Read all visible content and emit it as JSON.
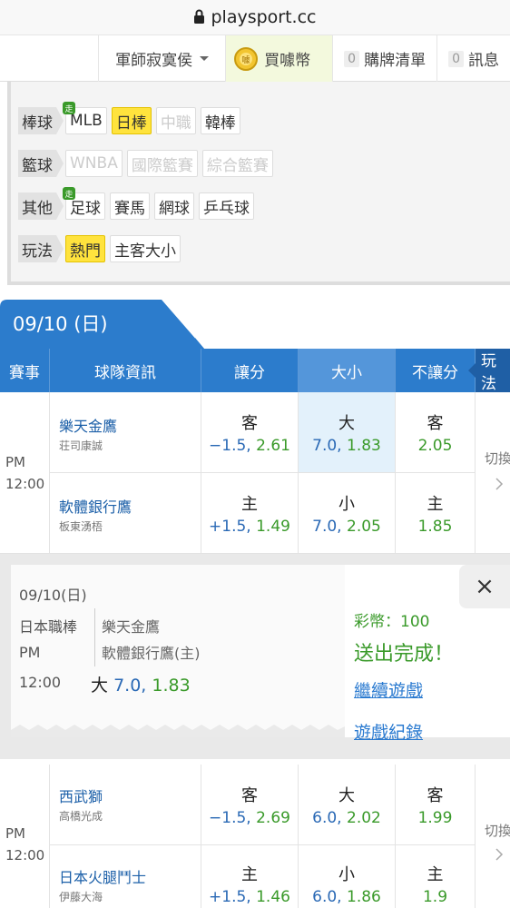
{
  "browser": {
    "url": "playsport.cc"
  },
  "topnav": {
    "user": "軍師寂寞侯",
    "coin": "買噱幣",
    "cart_count": "0",
    "cart": "購牌清單",
    "msg_count": "0",
    "msg": "訊息"
  },
  "filters": {
    "rows": [
      {
        "category": "棒球",
        "tags": [
          "MLB",
          "日棒",
          "中職",
          "韓棒"
        ]
      },
      {
        "category": "籃球",
        "tags": [
          "WNBA",
          "國際籃賽",
          "綜合籃賽"
        ]
      },
      {
        "category": "其他",
        "tags": [
          "足球",
          "賽馬",
          "網球",
          "乒乓球"
        ]
      },
      {
        "category": "玩法",
        "tags": [
          "熱門",
          "主客大小"
        ]
      }
    ],
    "walk_badge": "走"
  },
  "date_header": "09/10 (日)",
  "table_header": [
    "賽事",
    "球隊資訊",
    "讓分",
    "大小",
    "不讓分",
    "玩法"
  ],
  "games": [
    {
      "time_ampm": "PM",
      "time": "12:00",
      "switch": "切換",
      "away": {
        "team": "樂天金鷹",
        "pitcher": "荘司康誠",
        "spread_side": "客",
        "spread": "−1.5,",
        "spread_odds": "2.61",
        "ou_side": "大",
        "ou": "7.0,",
        "ou_odds": "1.83",
        "ml_side": "客",
        "ml": "2.05"
      },
      "home": {
        "team": "軟體銀行鷹",
        "pitcher": "板東湧梧",
        "spread_side": "主",
        "spread": "+1.5,",
        "spread_odds": "1.49",
        "ou_side": "小",
        "ou": "7.0,",
        "ou_odds": "2.05",
        "ml_side": "主",
        "ml": "1.85"
      }
    },
    {
      "time_ampm": "PM",
      "time": "12:00",
      "switch": "切換",
      "away": {
        "team": "西武獅",
        "pitcher": "高橋光成",
        "spread_side": "客",
        "spread": "−1.5,",
        "spread_odds": "2.69",
        "ou_side": "大",
        "ou": "6.0,",
        "ou_odds": "2.02",
        "ml_side": "客",
        "ml": "1.99"
      },
      "home": {
        "team": "日本火腿鬥士",
        "pitcher": "伊藤大海",
        "spread_side": "主",
        "spread": "+1.5,",
        "spread_odds": "1.46",
        "ou_side": "小",
        "ou": "6.0,",
        "ou_odds": "1.86",
        "ml_side": "主",
        "ml": "1.9"
      }
    }
  ],
  "popup": {
    "date": "09/10(日)",
    "league": "日本職棒",
    "ampm": "PM",
    "time": "12:00",
    "away": "樂天金鷹",
    "home": "軟體銀行鷹(主)",
    "pick_side": "大",
    "pick_line": "7.0,",
    "pick_odds": "1.83",
    "coins": "彩幣：100",
    "done": "送出完成！",
    "continue": "繼續遊戲",
    "record": "遊戲紀錄",
    "close": "×"
  },
  "colors": {
    "header_blue": "#2c7ccc",
    "link_blue": "#2a69b5",
    "odds_green": "#3a9a2a",
    "selected_yellow": "#ffe33d",
    "highlight_cell": "#e3f1fb"
  },
  "icons": [
    "lock-icon",
    "caret-down-icon",
    "coin-icon",
    "walk-badge-icon",
    "chevron-right-icon",
    "close-icon"
  ]
}
